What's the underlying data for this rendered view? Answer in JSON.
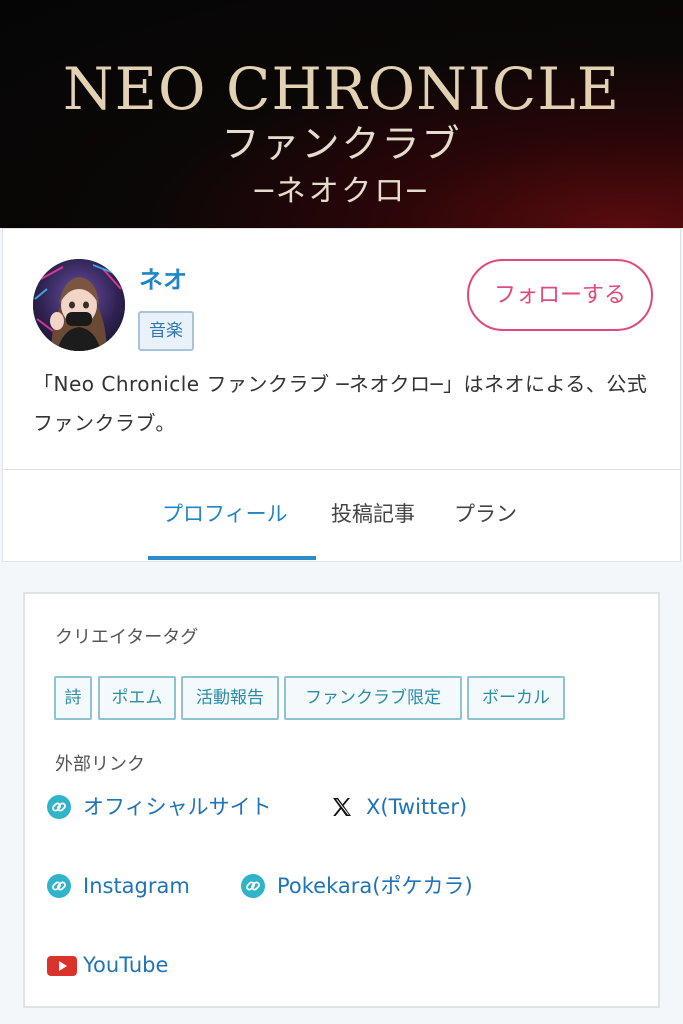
{
  "banner": {
    "title": "NEO CHRONICLE",
    "subtitle": "ファンクラブ",
    "subtitle2": "─ネオクロ─"
  },
  "profile": {
    "name": "ネオ",
    "category": "音楽",
    "follow_label": "フォローする",
    "description": "「Neo Chronicle ファンクラブ ─ネオクロ─」はネオによる、公式ファンクラブ。"
  },
  "tabs": [
    {
      "label": "プロフィール",
      "active": true
    },
    {
      "label": "投稿記事",
      "active": false
    },
    {
      "label": "プラン",
      "active": false
    }
  ],
  "creator_tags": {
    "label": "クリエイタータグ",
    "items": [
      "詩",
      "ポエム",
      "活動報告",
      "ファンクラブ限定",
      "ボーカル"
    ]
  },
  "external_links": {
    "label": "外部リンク",
    "items": [
      {
        "label": "オフィシャルサイト",
        "icon": "link-icon"
      },
      {
        "label": "X(Twitter)",
        "icon": "x-icon"
      },
      {
        "label": "Instagram",
        "icon": "link-icon"
      },
      {
        "label": "Pokekara(ポケカラ)",
        "icon": "link-icon"
      },
      {
        "label": "YouTube",
        "icon": "youtube-icon"
      }
    ]
  },
  "colors": {
    "accent_blue": "#1f86c6",
    "follow_pink": "#e2487a",
    "tag_teal": "#2d8ca5",
    "youtube_red": "#d9332b"
  }
}
